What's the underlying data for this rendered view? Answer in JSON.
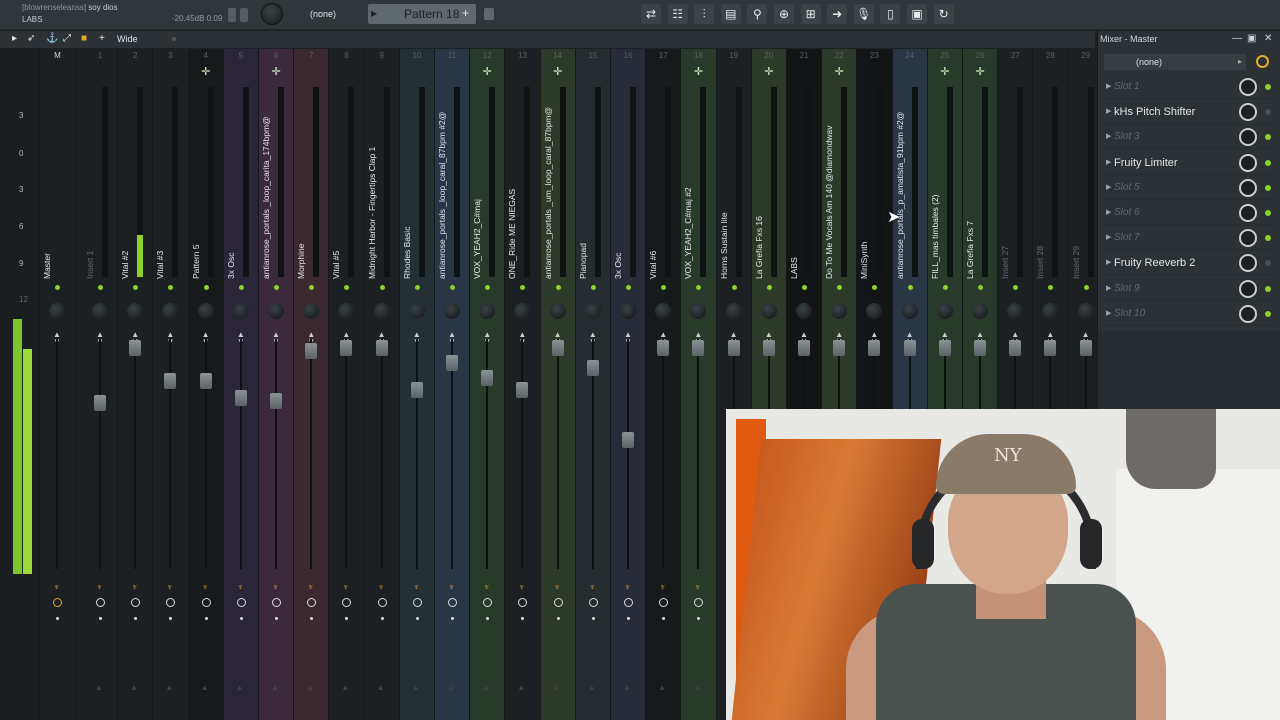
{
  "header": {
    "hint_prefix": "[blowrenseleanss]",
    "hint_title": "soy  dios",
    "hint_sub": "LABS",
    "db_readout": "-20.45dB  0.09",
    "pattern_selector": "(none)",
    "pattern": "Pattern 18",
    "pattern_add": "+",
    "tool_icons": [
      "arrow-pattern-icon",
      "playlist-icon",
      "mixer-icon",
      "piano-roll-icon",
      "plugin-icon",
      "channel-rack-icon",
      "browser-icon",
      "arrow-right-icon",
      "mic-icon",
      "file-icon",
      "stamp-icon",
      "refresh-icon"
    ]
  },
  "mixer_toolbar": {
    "view": "Wide",
    "icons": [
      "arrow-right-icon",
      "cursor-icon",
      "anchor-icon",
      "expand-icon",
      "folder-icon",
      "plus-icon"
    ]
  },
  "master": {
    "label": "M",
    "name": "Master",
    "scale": [
      "3",
      "0",
      "3",
      "6",
      "9",
      "12"
    ]
  },
  "tracks": [
    {
      "num": "1",
      "name": "Insert 1",
      "tint": "#1d2023",
      "route": false,
      "fader": 395,
      "dim": true
    },
    {
      "num": "2",
      "name": "Vital #2",
      "tint": "#1d2023",
      "route": false,
      "fader": 340,
      "dim": false
    },
    {
      "num": "3",
      "name": "Vital #3",
      "tint": "#1d2023",
      "route": false,
      "fader": 373,
      "dim": false
    },
    {
      "num": "4",
      "name": "Pattern 5",
      "tint": "#171a1b",
      "route": true,
      "fader": 373,
      "dim": false
    },
    {
      "num": "5",
      "name": "3x Osc",
      "tint": "#2a2638",
      "route": false,
      "fader": 390,
      "dim": false
    },
    {
      "num": "6",
      "name": "@antianrose_portals _loop_carita_174bpm",
      "tint": "#3a2a3c",
      "route": true,
      "fader": 393,
      "dim": false
    },
    {
      "num": "7",
      "name": "Morphine",
      "tint": "#3a2a30",
      "route": false,
      "fader": 343,
      "dim": false
    },
    {
      "num": "8",
      "name": "Vital #5",
      "tint": "#1d2023",
      "route": false,
      "fader": 340,
      "dim": false
    },
    {
      "num": "9",
      "name": "Midnight Harbor - Fingertips Clap 1",
      "tint": "#1d2023",
      "route": false,
      "fader": 340,
      "dim": false
    },
    {
      "num": "10",
      "name": "Rhodes Basic",
      "tint": "#253035",
      "route": false,
      "fader": 382,
      "dim": false
    },
    {
      "num": "11",
      "name": "@antianrose_portals _loop_caral_87bpm #2",
      "tint": "#2a3545",
      "route": false,
      "fader": 355,
      "dim": false
    },
    {
      "num": "12",
      "name": "VOX_YEAH2_C#maj",
      "tint": "#2a3a2a",
      "route": true,
      "fader": 370,
      "dim": false
    },
    {
      "num": "13",
      "name": "ONE_Ride ME NIEGAS",
      "tint": "#1d2023",
      "route": false,
      "fader": 382,
      "dim": false
    },
    {
      "num": "14",
      "name": "@antianrose_portals _um_loop_caral_87bpm",
      "tint": "#2d3a2a",
      "route": true,
      "fader": 340,
      "dim": false
    },
    {
      "num": "15",
      "name": "Pianopad",
      "tint": "#252d30",
      "route": false,
      "fader": 360,
      "dim": false
    },
    {
      "num": "16",
      "name": "3x Osc",
      "tint": "#272c38",
      "route": false,
      "fader": 432,
      "dim": false
    },
    {
      "num": "17",
      "name": "Vital #6",
      "tint": "#171a1b",
      "route": false,
      "fader": 340,
      "dim": false
    },
    {
      "num": "18",
      "name": "VOX_YEAH2_C#maj #2",
      "tint": "#2a3a2a",
      "route": true,
      "fader": 340,
      "dim": false
    },
    {
      "num": "19",
      "name": "Horns Sustain lite",
      "tint": "#1d2023",
      "route": false,
      "fader": 340,
      "dim": false
    },
    {
      "num": "20",
      "name": "La Grefia Fxs 16",
      "tint": "#2d3a2a",
      "route": true,
      "fader": 340,
      "dim": false
    },
    {
      "num": "21",
      "name": "LABS",
      "tint": "#121415",
      "route": false,
      "fader": 340,
      "dim": false
    },
    {
      "num": "22",
      "name": "Do To Me Vocals Am 140 @diamondwav",
      "tint": "#2d3a2a",
      "route": true,
      "fader": 340,
      "dim": false
    },
    {
      "num": "23",
      "name": "MiniSynth",
      "tint": "#121415",
      "route": false,
      "fader": 340,
      "dim": false
    },
    {
      "num": "24",
      "name": "@antianrose_portals_p_amatista_91bpm #2",
      "tint": "#2a3545",
      "route": false,
      "fader": 340,
      "dim": false
    },
    {
      "num": "25",
      "name": "FILL_mas timbales (2)",
      "tint": "#2a3a2a",
      "route": true,
      "fader": 340,
      "dim": false
    },
    {
      "num": "26",
      "name": "La Grefia Fxs 7",
      "tint": "#2a3a2a",
      "route": true,
      "fader": 340,
      "dim": false
    },
    {
      "num": "27",
      "name": "Insert 27",
      "tint": "#1d2023",
      "route": false,
      "fader": 340,
      "dim": true
    },
    {
      "num": "28",
      "name": "Insert 28",
      "tint": "#1d2023",
      "route": false,
      "fader": 340,
      "dim": true
    },
    {
      "num": "29",
      "name": "Insert 29",
      "tint": "#1d2023",
      "route": false,
      "fader": 340,
      "dim": true
    }
  ],
  "panel": {
    "title": "Mixer - Master",
    "input": "(none)",
    "slots": [
      {
        "name": "Slot 1",
        "empty": true,
        "led": true
      },
      {
        "name": "kHs Pitch Shifter",
        "empty": false,
        "led": false
      },
      {
        "name": "Slot 3",
        "empty": true,
        "led": true
      },
      {
        "name": "Fruity Limiter",
        "empty": false,
        "led": true
      },
      {
        "name": "Slot 5",
        "empty": true,
        "led": true
      },
      {
        "name": "Slot 6",
        "empty": true,
        "led": true
      },
      {
        "name": "Slot 7",
        "empty": true,
        "led": true
      },
      {
        "name": "Fruity Reeverb 2",
        "empty": false,
        "led": false
      },
      {
        "name": "Slot 9",
        "empty": true,
        "led": true
      },
      {
        "name": "Slot 10",
        "empty": true,
        "led": true
      }
    ]
  }
}
